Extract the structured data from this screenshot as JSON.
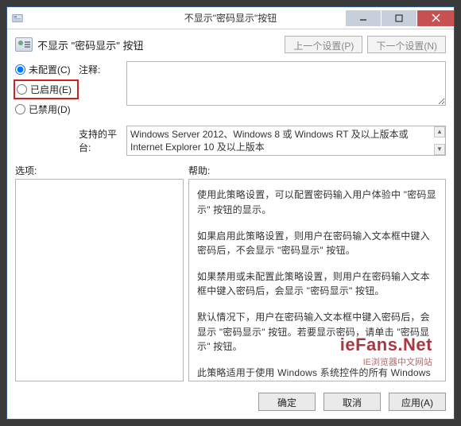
{
  "window": {
    "title": "不显示\"密码显示\"按钮",
    "minimize_tooltip": "最小化",
    "maximize_tooltip": "最大化",
    "close_tooltip": "关闭"
  },
  "header": {
    "policy_title": "不显示 \"密码显示\" 按钮",
    "prev_btn": "上一个设置(P)",
    "next_btn": "下一个设置(N)"
  },
  "radios": {
    "not_configured": "未配置(C)",
    "enabled": "已启用(E)",
    "disabled": "已禁用(D)",
    "selected": "not_configured"
  },
  "labels": {
    "comment": "注释:",
    "platform": "支持的平台:",
    "options": "选项:",
    "help": "帮助:"
  },
  "platform_text": "Windows Server 2012、Windows 8 或 Windows RT 及以上版本或 Internet Explorer 10 及以上版本",
  "help_paragraphs": [
    "使用此策略设置，可以配置密码输入用户体验中 \"密码显示\" 按钮的显示。",
    "如果启用此策略设置，则用户在密码输入文本框中键入密码后，不会显示 \"密码显示\" 按钮。",
    "如果禁用或未配置此策略设置，则用户在密码输入文本框中键入密码后，会显示 \"密码显示\" 按钮。",
    "默认情况下，用户在密码输入文本框中键入密码后，会显示 \"密码显示\" 按钮。若要显示密码，请单击 \"密码显示\" 按钮。",
    "此策略适用于使用 Windows 系统控件的所有 Windows 组件和应用程序，包括 Internet Explorer。"
  ],
  "footer": {
    "ok": "确定",
    "cancel": "取消",
    "apply": "应用(A)"
  },
  "watermark": {
    "brand": "ieFans.Net",
    "sub": "IE浏览器中文网站"
  }
}
